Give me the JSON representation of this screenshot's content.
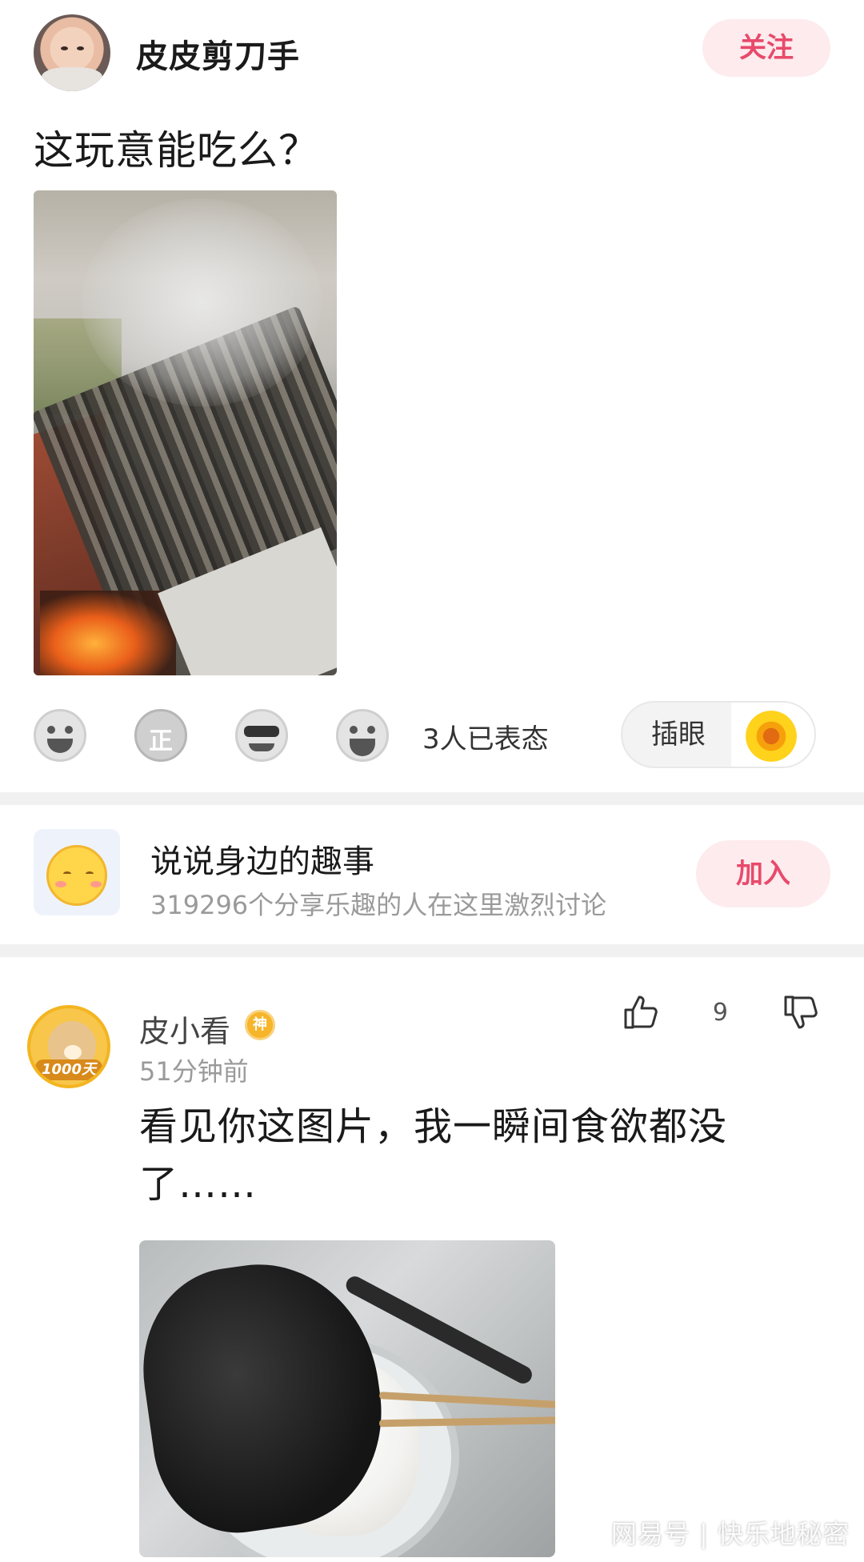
{
  "post": {
    "author": "皮皮剪刀手",
    "follow_label": "关注",
    "text": "这玩意能吃么？",
    "photo_icon": "bbq-skewers-photo"
  },
  "reactions": {
    "icons": [
      "laughing-face-icon",
      "zheng-icon",
      "sunglasses-face-icon",
      "grinning-face-icon"
    ],
    "zheng_glyph": "正",
    "count_text": "3人已表态",
    "chayan_label": "插眼",
    "chayan_icon": "sunflower-icon"
  },
  "topic": {
    "title": "说说身边的趣事",
    "subtitle": "319296个分享乐趣的人在这里激烈讨论",
    "join_label": "加入"
  },
  "comment": {
    "user": "皮小看",
    "badge": "神",
    "avatar_badge": "1000天",
    "time": "51分钟前",
    "like_count": "9",
    "text": "看见你这图片，我一瞬间食欲都没了……"
  },
  "watermark": "网易号 | 快乐地秘密",
  "colors": {
    "accent_pink": "#e84a6b",
    "pill_pink_bg": "#fdebee",
    "divider": "#f1f1f1",
    "muted_text": "#9a9a9a"
  }
}
